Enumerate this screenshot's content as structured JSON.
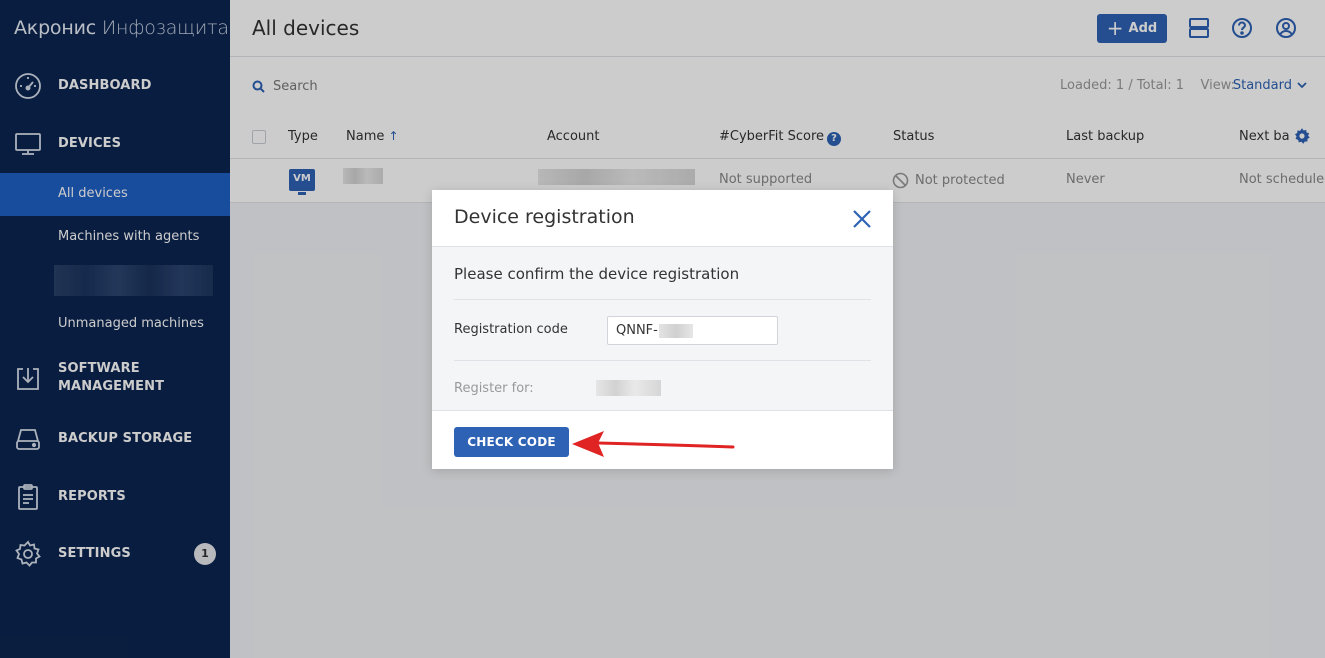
{
  "brand": {
    "part1": "Акронис",
    "part2": "Инфозащита"
  },
  "sidebar": {
    "dashboard": "DASHBOARD",
    "devices": "DEVICES",
    "sub": [
      "All devices",
      "Machines with agents",
      "Unmanaged machines"
    ],
    "software_line1": "SOFTWARE",
    "software_line2": "MANAGEMENT",
    "backup_storage": "BACKUP STORAGE",
    "reports": "REPORTS",
    "settings": "SETTINGS",
    "settings_badge": "1"
  },
  "header": {
    "title": "All devices",
    "add_label": "Add"
  },
  "toolbar": {
    "search_placeholder": "Search",
    "loaded_text": "Loaded: 1 / Total: 1",
    "view_label": "View:",
    "view_value": "Standard"
  },
  "table": {
    "columns": [
      "Type",
      "Name",
      "Account",
      "#CyberFit Score",
      "Status",
      "Last backup",
      "Next ba"
    ],
    "row": {
      "type": "VM",
      "cyberfit": "Not supported",
      "status": "Not protected",
      "last_backup": "Never",
      "next_backup": "Not scheduled"
    }
  },
  "modal": {
    "title": "Device registration",
    "confirm_text": "Please confirm the device registration",
    "code_label": "Registration code",
    "code_value": "QNNF-",
    "register_for_label": "Register for:",
    "check_button": "CHECK CODE"
  },
  "colors": {
    "sidebar_bg": "#0c2550",
    "accent": "#2e62b5",
    "active_nav": "#1e5fc4",
    "annotation_arrow": "#e02424"
  }
}
